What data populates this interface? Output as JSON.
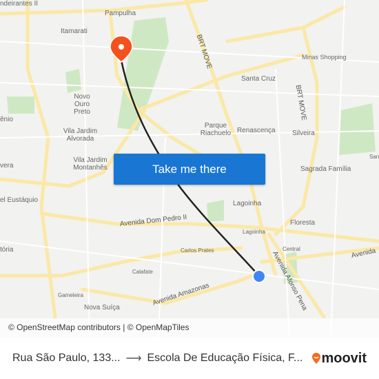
{
  "map": {
    "labels": [
      "ndeirantes II",
      "Pampulha",
      "Itamarati",
      "Novo Ouro Preto",
      "Vila Jardim Alvorada",
      "Vila Jardim Montanhês",
      "Santa Cruz",
      "Minas Shopping",
      "Parque Riachuelo",
      "Renascença",
      "Silveira",
      "Sagrada Família",
      "Lagoinha",
      "Lagoinha",
      "Floresta",
      "Carlos Prates",
      "Central",
      "Calafate",
      "Gameleira",
      "Nova Suíça",
      "ênio",
      "vera",
      "el Eustáquio",
      "tória",
      "San"
    ],
    "roads": [
      "BRT MOVE",
      "BRT MOVE",
      "Avenida Dom Pedro II",
      "Avenida Afonso Pena",
      "Avenida Amazonas",
      "Avenida"
    ],
    "origin_color": "#4285f4",
    "destination_color": "#f4511e",
    "route_color": "#222222"
  },
  "cta": {
    "label": "Take me there"
  },
  "attribution": "© OpenStreetMap contributors | © OpenMapTiles",
  "footer": {
    "origin": "Rua São Paulo, 133...",
    "arrow": "⟶",
    "destination": "Escola De Educação Física, F...",
    "brand": "moovit",
    "brand_color": "#f26d21"
  }
}
